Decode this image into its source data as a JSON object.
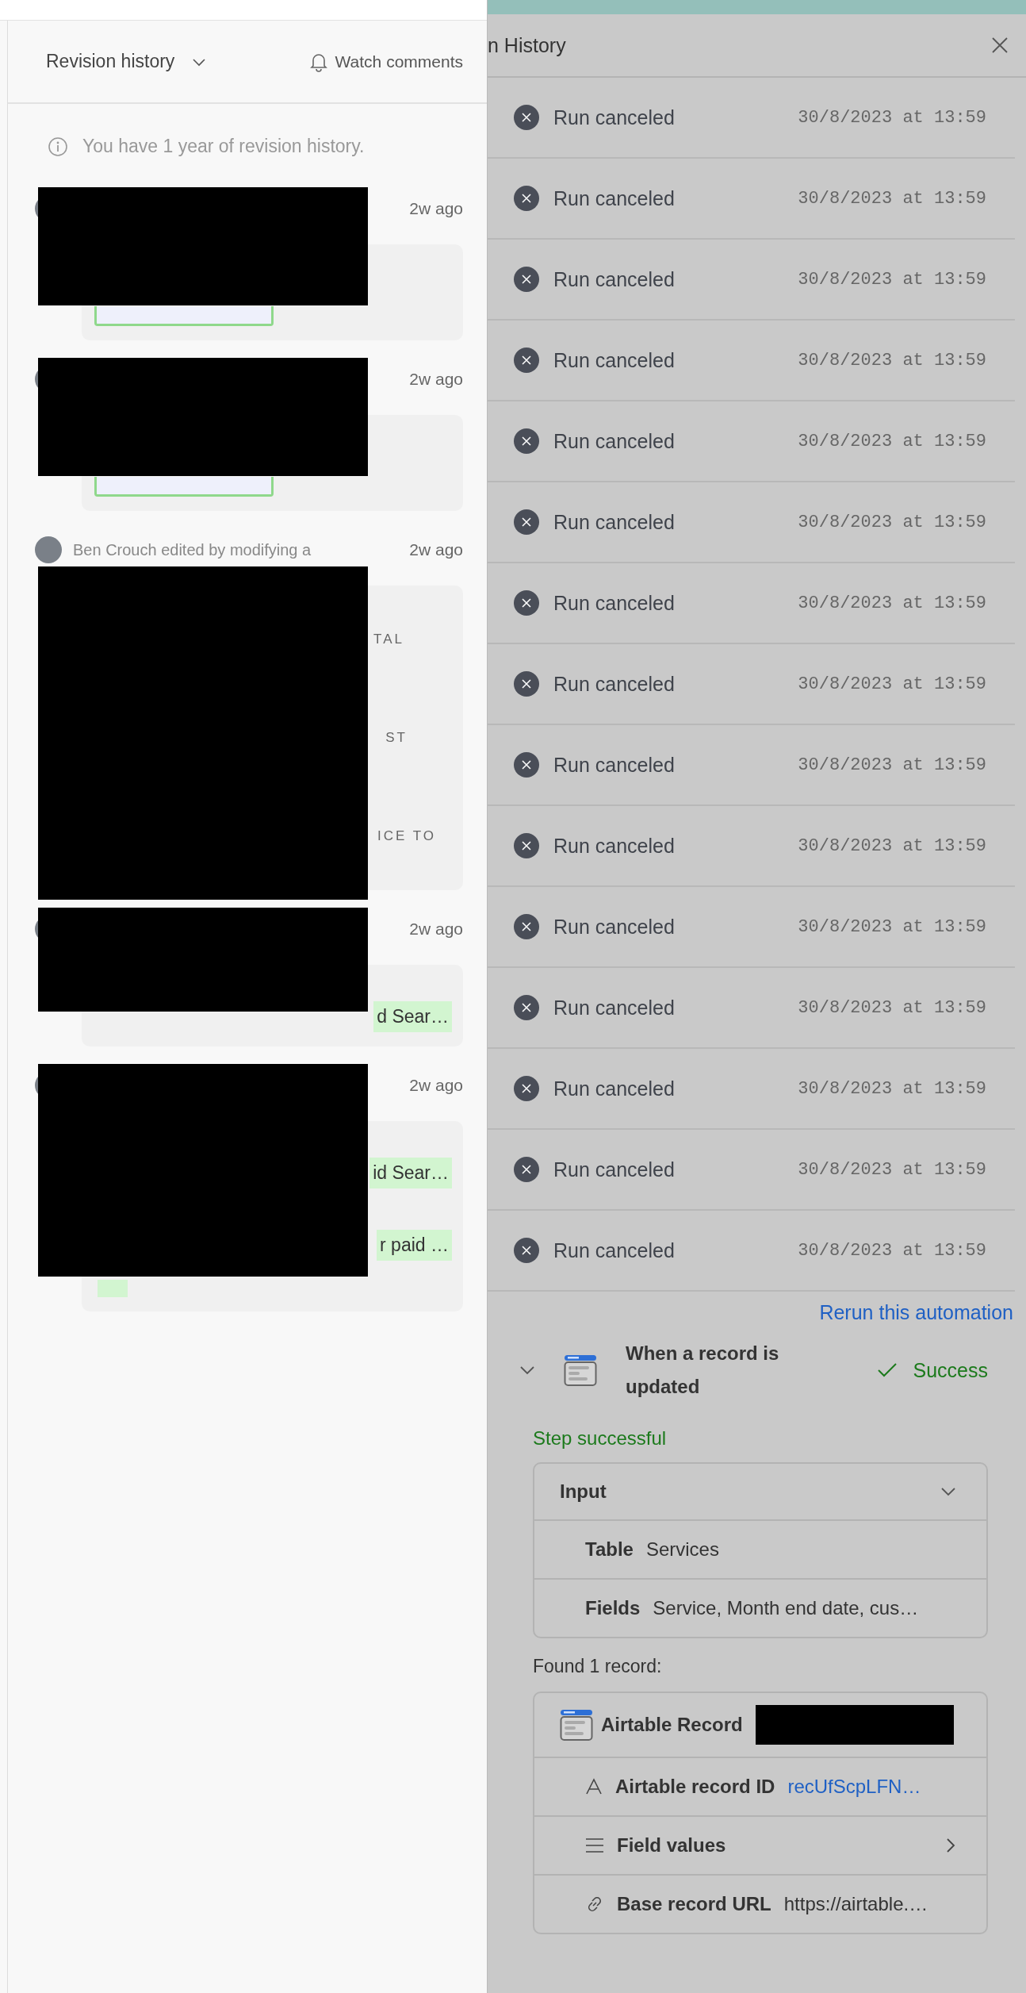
{
  "revision_panel": {
    "title": "Revision history",
    "watch_label": "Watch comments",
    "notice": "You have 1 year of revision history.",
    "entries": [
      {
        "time": "2w ago",
        "redacted": true,
        "fragments": [
          {
            "kind": "chip-edge"
          }
        ]
      },
      {
        "time": "2w ago",
        "redacted": true,
        "fragments": [
          {
            "kind": "chip-edge"
          }
        ]
      },
      {
        "time": "2w ago",
        "summary": "Ben Crouch edited by modifying a",
        "redacted": true,
        "fragments": [
          {
            "kind": "caps",
            "text": "TAL"
          },
          {
            "kind": "caps",
            "text": "ST"
          },
          {
            "kind": "caps",
            "text": "ICE TO"
          }
        ]
      },
      {
        "time": "2w ago",
        "redacted": true,
        "fragments": [
          {
            "kind": "highlight",
            "text": "d Sear…"
          }
        ]
      },
      {
        "time": "2w ago",
        "redacted": true,
        "fragments": [
          {
            "kind": "highlight",
            "text": "id Sear…"
          },
          {
            "kind": "highlight",
            "text": "r paid …"
          },
          {
            "kind": "highlight-edge"
          }
        ]
      }
    ]
  },
  "run_panel": {
    "title": "n History",
    "runs": [
      {
        "status": "Run canceled",
        "time": "30/8/2023 at 13:59"
      },
      {
        "status": "Run canceled",
        "time": "30/8/2023 at 13:59"
      },
      {
        "status": "Run canceled",
        "time": "30/8/2023 at 13:59"
      },
      {
        "status": "Run canceled",
        "time": "30/8/2023 at 13:59"
      },
      {
        "status": "Run canceled",
        "time": "30/8/2023 at 13:59"
      },
      {
        "status": "Run canceled",
        "time": "30/8/2023 at 13:59"
      },
      {
        "status": "Run canceled",
        "time": "30/8/2023 at 13:59"
      },
      {
        "status": "Run canceled",
        "time": "30/8/2023 at 13:59"
      },
      {
        "status": "Run canceled",
        "time": "30/8/2023 at 13:59"
      },
      {
        "status": "Run canceled",
        "time": "30/8/2023 at 13:59"
      },
      {
        "status": "Run canceled",
        "time": "30/8/2023 at 13:59"
      },
      {
        "status": "Run canceled",
        "time": "30/8/2023 at 13:59"
      },
      {
        "status": "Run canceled",
        "time": "30/8/2023 at 13:59"
      },
      {
        "status": "Run canceled",
        "time": "30/8/2023 at 13:59"
      },
      {
        "status": "Run canceled",
        "time": "30/8/2023 at 13:59"
      }
    ],
    "rerun_link": "Rerun this automation",
    "step": {
      "expanded": true,
      "title": "When a record is updated",
      "status": "Success",
      "result": "Step successful",
      "input": {
        "title": "Input",
        "expanded": true,
        "rows": [
          {
            "label": "Table",
            "value": "Services"
          },
          {
            "label": "Fields",
            "value": "Service, Month end date, cus…"
          }
        ]
      },
      "found": "Found 1 record:",
      "record": {
        "title": "Airtable Record",
        "redacted": true,
        "rows": [
          {
            "kind": "text",
            "label": "Airtable record ID",
            "value": "recUfScpLFN…"
          },
          {
            "kind": "list",
            "label": "Field values"
          },
          {
            "kind": "link",
            "label": "Base record URL",
            "value": "https://airtable.…"
          }
        ]
      }
    }
  }
}
